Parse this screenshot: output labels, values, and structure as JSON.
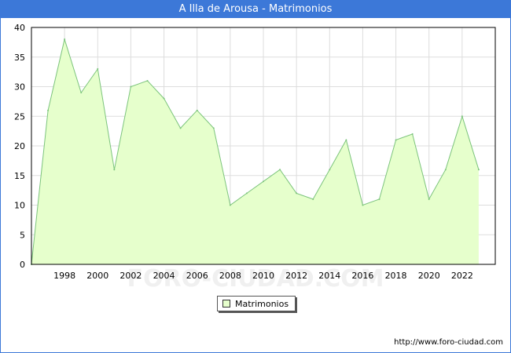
{
  "header": {
    "title": "A Illa de Arousa - Matrimonios"
  },
  "watermark": "FORO-CIUDAD.COM",
  "source_url": "http://www.foro-ciudad.com",
  "colors": {
    "title_bar": "#3c78d8",
    "area_fill": "#e6ffcc",
    "line": "#7cc47c",
    "grid": "#dddddd"
  },
  "chart_data": {
    "type": "area",
    "title": "A Illa de Arousa - Matrimonios",
    "xlabel": "",
    "ylabel": "",
    "x": [
      1996,
      1997,
      1998,
      1999,
      2000,
      2001,
      2002,
      2003,
      2004,
      2005,
      2006,
      2007,
      2008,
      2009,
      2010,
      2011,
      2012,
      2013,
      2014,
      2015,
      2016,
      2017,
      2018,
      2019,
      2020,
      2021,
      2022,
      2023
    ],
    "series": [
      {
        "name": "Matrimonios",
        "values": [
          0,
          26,
          38,
          29,
          33,
          16,
          30,
          31,
          28,
          23,
          26,
          23,
          10,
          12,
          14,
          16,
          12,
          11,
          16,
          21,
          10,
          11,
          21,
          22,
          11,
          16,
          25,
          16
        ]
      }
    ],
    "xlim": [
      1996,
      2024
    ],
    "ylim": [
      0,
      40
    ],
    "x_ticks": [
      1998,
      2000,
      2002,
      2004,
      2006,
      2008,
      2010,
      2012,
      2014,
      2016,
      2018,
      2020,
      2022
    ],
    "y_ticks": [
      0,
      5,
      10,
      15,
      20,
      25,
      30,
      35,
      40
    ],
    "grid": true,
    "legend_position": "bottom-center"
  }
}
